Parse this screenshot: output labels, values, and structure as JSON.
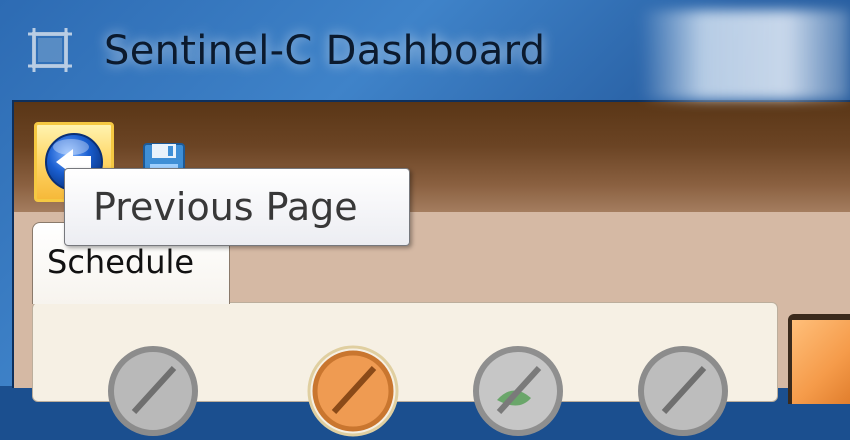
{
  "window": {
    "title": "Sentinel-C Dashboard",
    "icon": "crosshair-window-icon"
  },
  "toolbar": {
    "back_icon": "back-arrow-icon",
    "save_icon": "floppy-disk-icon"
  },
  "tabs": [
    {
      "label": "Schedule",
      "selected": true
    }
  ],
  "tooltip": {
    "text": "Previous Page"
  },
  "colors": {
    "toolbar_top": "#5a3616",
    "toolbar_bottom": "#a47d5f",
    "client_bg": "#d5b9a4",
    "highlight_border": "#f5c842",
    "back_icon_blue": "#1a5fd1"
  }
}
